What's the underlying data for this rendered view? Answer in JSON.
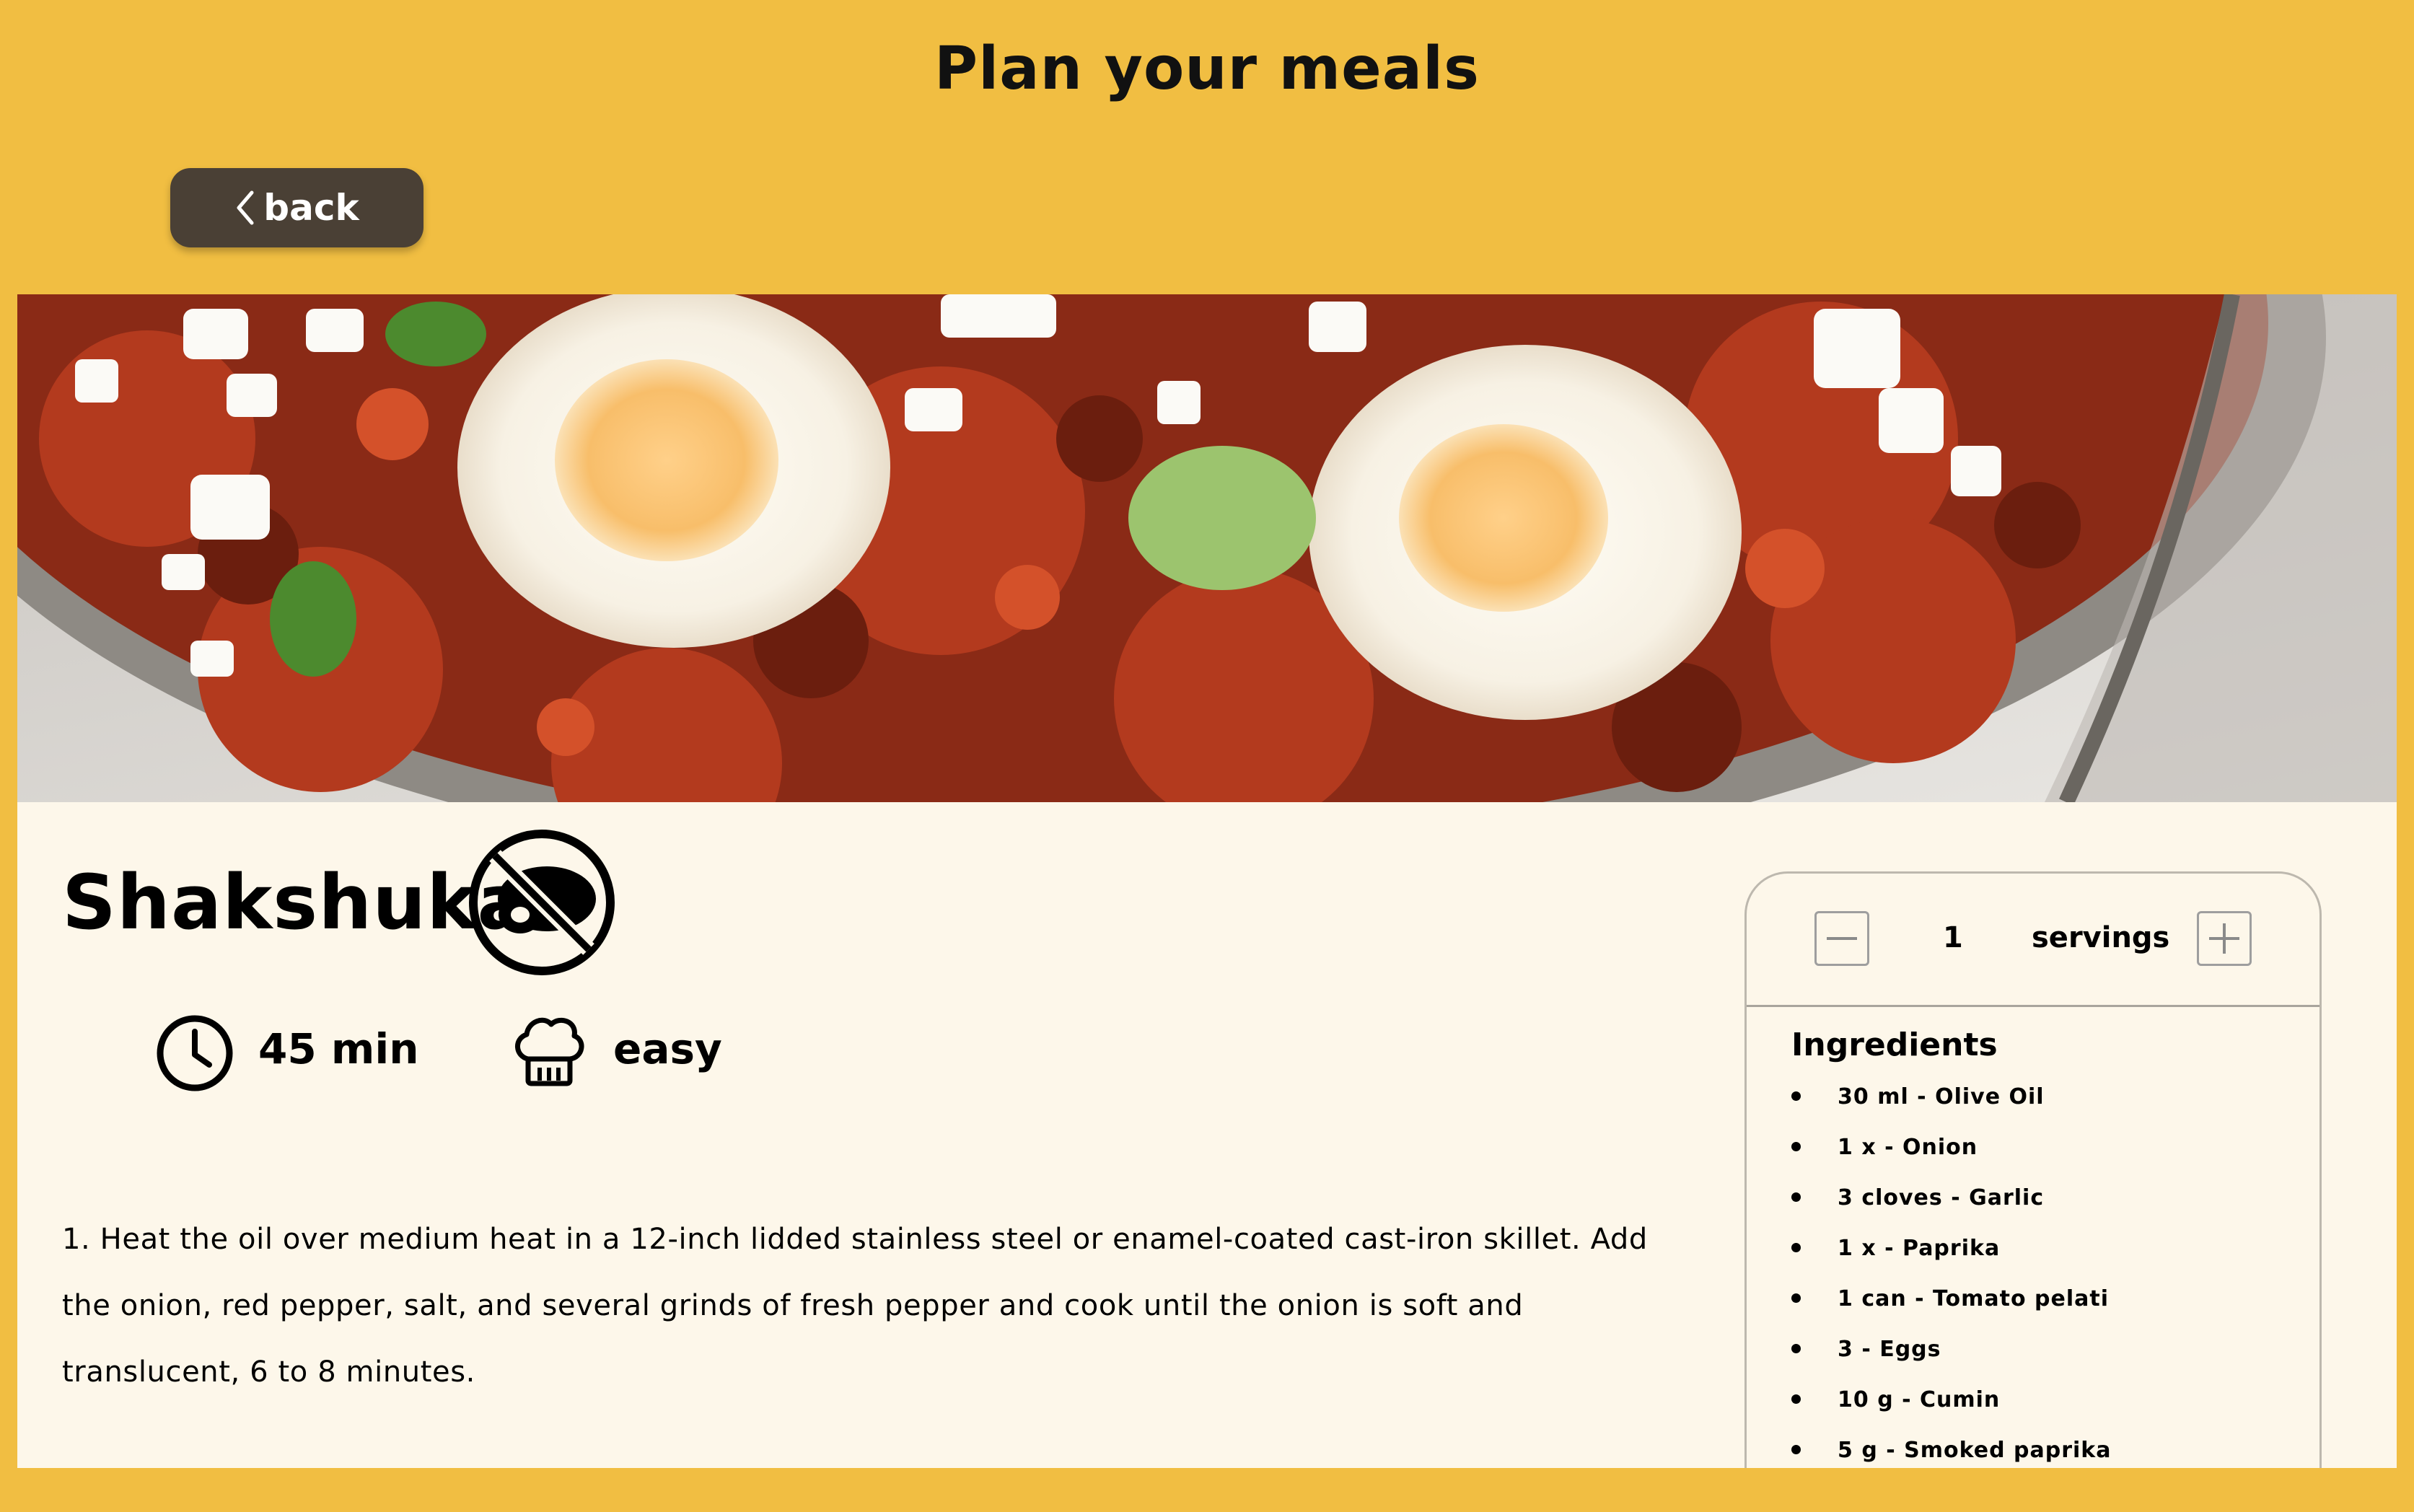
{
  "app": {
    "title": "Plan your meals"
  },
  "nav": {
    "back_label": "back"
  },
  "recipe": {
    "name": "Shakshuka",
    "diet_badge_icon": "no-meat-icon",
    "time": "45 min",
    "difficulty": "easy",
    "instructions": "1. Heat the oil over medium heat in a 12-inch lidded stainless steel or enamel-coated cast-iron skillet. Add the onion, red pepper, salt, and several grinds of fresh pepper and cook until the onion is soft and translucent, 6 to 8 minutes."
  },
  "servings": {
    "count": "1",
    "label": "servings"
  },
  "ingredients": {
    "title": "Ingredients",
    "items": [
      "30 ml - Olive Oil",
      "1 x - Onion",
      "3 cloves - Garlic",
      "1 x - Paprika",
      "1 can - Tomato pelati",
      "3 - Eggs",
      "10 g - Cumin",
      "5 g - Smoked paprika"
    ]
  },
  "colors": {
    "background": "#F1BE42",
    "card": "#FDF7EA",
    "button": "#4A4035"
  }
}
